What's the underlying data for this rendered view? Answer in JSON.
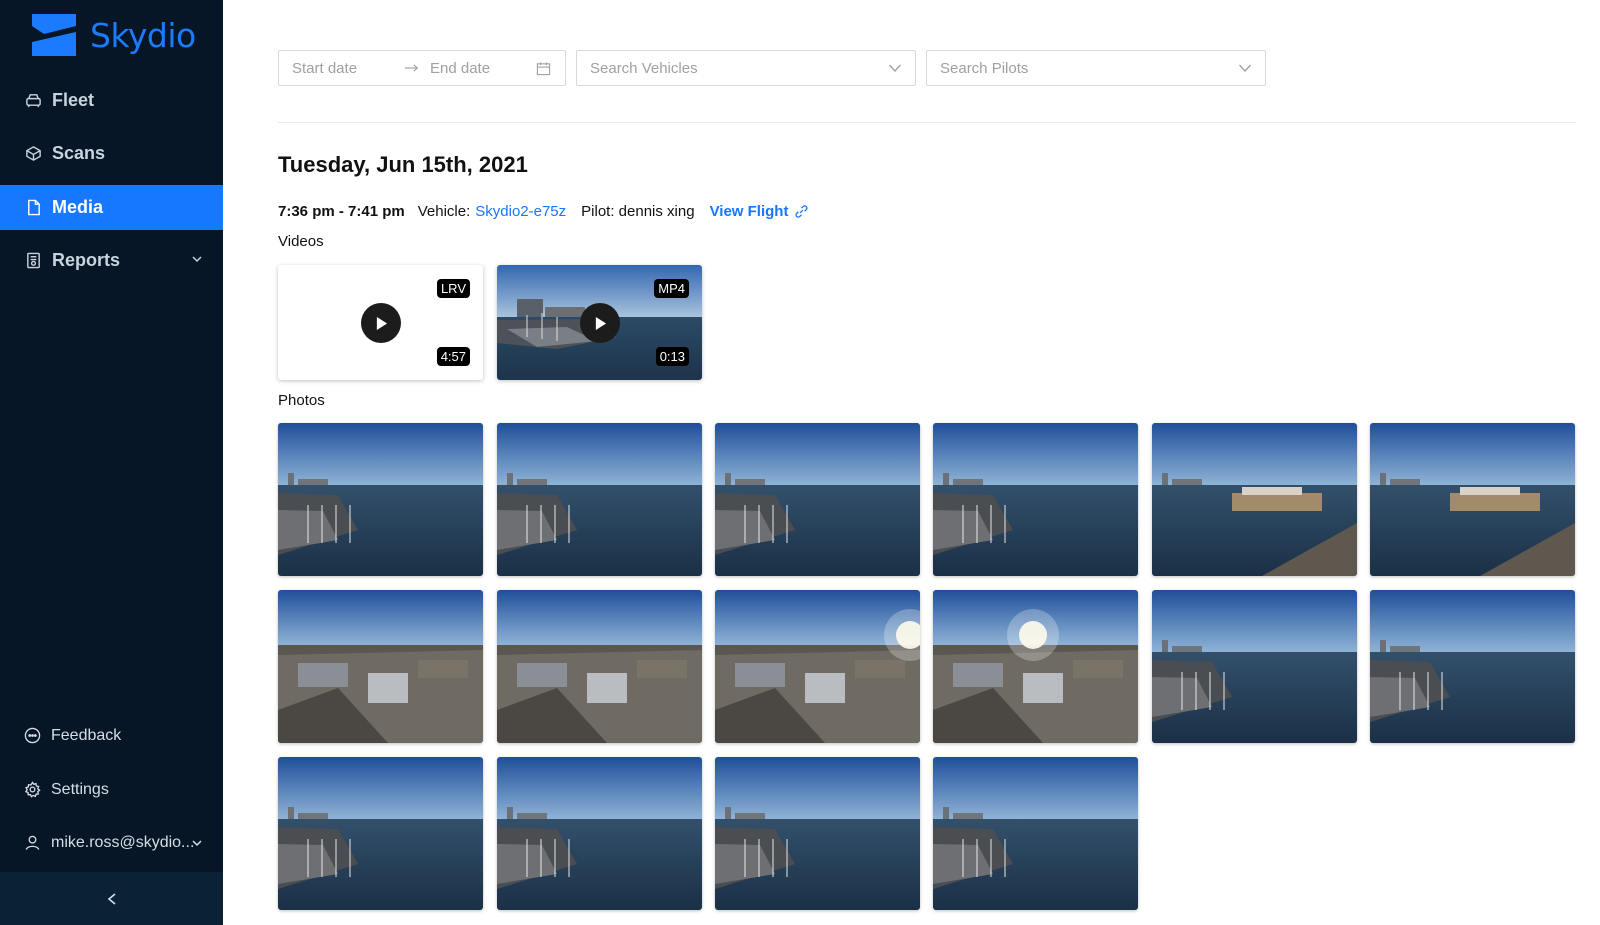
{
  "brand": {
    "name": "Skydio",
    "color": "#1a7bff"
  },
  "sidebar": {
    "items": [
      {
        "label": "Fleet",
        "icon": "car-icon"
      },
      {
        "label": "Scans",
        "icon": "scan-icon"
      },
      {
        "label": "Media",
        "icon": "file-icon",
        "active": true
      },
      {
        "label": "Reports",
        "icon": "report-icon"
      }
    ],
    "bottom": {
      "feedback": "Feedback",
      "settings": "Settings",
      "user": "mike.ross@skydio..."
    }
  },
  "filters": {
    "start_placeholder": "Start date",
    "end_placeholder": "End date",
    "vehicles_placeholder": "Search Vehicles",
    "pilots_placeholder": "Search Pilots"
  },
  "session": {
    "date": "Tuesday, Jun 15th, 2021",
    "time": "7:36 pm - 7:41 pm",
    "vehicle_label": "Vehicle:",
    "vehicle": "Skydio2-e75z",
    "pilot": "Pilot: dennis xing",
    "view_flight": "View Flight"
  },
  "videos_label": "Videos",
  "videos": [
    {
      "format": "LRV",
      "duration": "4:57"
    },
    {
      "format": "MP4",
      "duration": "0:13"
    }
  ],
  "photos_label": "Photos",
  "photos_count": 16,
  "accent": "#1677ff",
  "link_color": "#1677ff"
}
